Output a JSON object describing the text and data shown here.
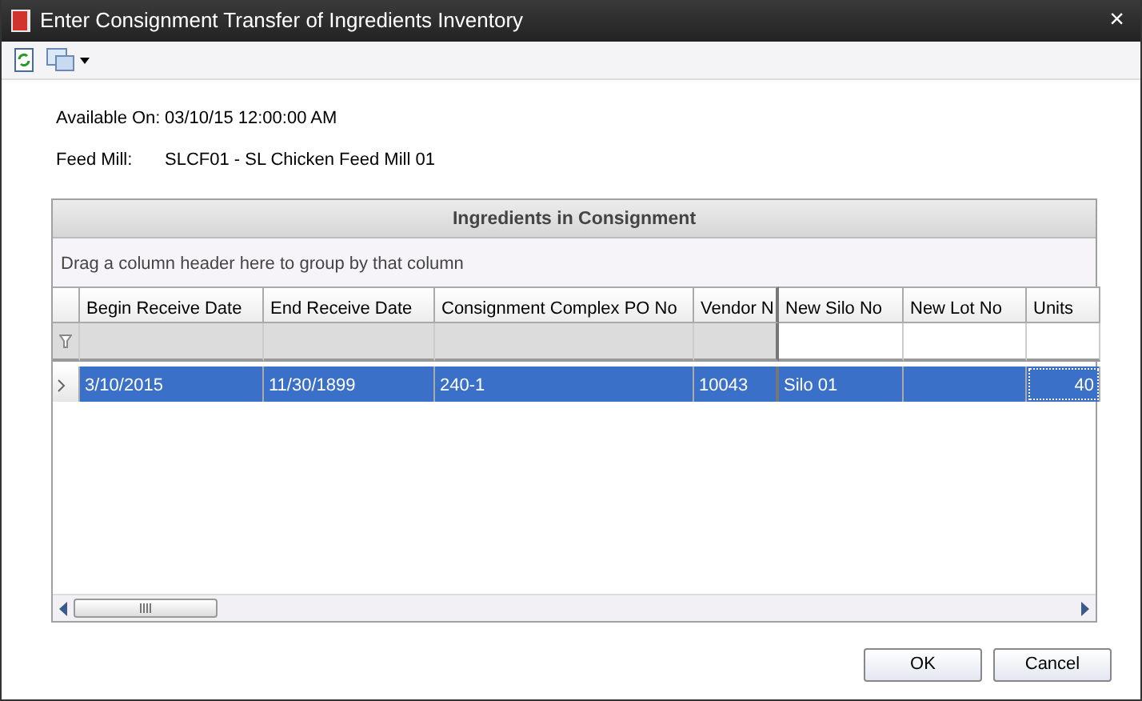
{
  "window": {
    "title": "Enter Consignment Transfer of Ingredients Inventory",
    "close": "×"
  },
  "fields": [
    {
      "label": "Available On:",
      "value": "03/10/15 12:00:00 AM"
    },
    {
      "label": "Feed Mill:",
      "value": "SLCF01 - SL Chicken Feed Mill 01"
    }
  ],
  "grid": {
    "title": "Ingredients in Consignment",
    "group_hint": "Drag a column header here to group by that column",
    "columns": [
      {
        "label": "Begin Receive Date",
        "frozen": true
      },
      {
        "label": "End Receive Date",
        "frozen": true
      },
      {
        "label": "Consignment Complex PO No",
        "frozen": true
      },
      {
        "label": "Vendor N",
        "frozen": true
      },
      {
        "label": "New Silo No",
        "frozen": false
      },
      {
        "label": "New Lot No",
        "frozen": false
      },
      {
        "label": "Units",
        "frozen": false
      }
    ],
    "rows": [
      {
        "selected": true,
        "cells": [
          "3/10/2015",
          "11/30/1899",
          "240-1",
          "10043",
          "Silo 01",
          "",
          "40"
        ]
      }
    ]
  },
  "buttons": [
    "OK",
    "Cancel"
  ]
}
